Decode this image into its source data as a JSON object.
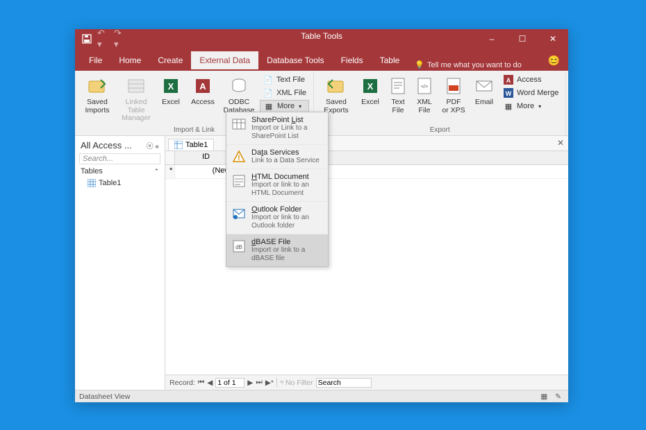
{
  "titlebar": {
    "center": "Table Tools",
    "minimize": "–",
    "maximize": "☐",
    "close": "✕"
  },
  "tabs": {
    "file": "File",
    "home": "Home",
    "create": "Create",
    "external": "External Data",
    "dbtools": "Database Tools",
    "fields": "Fields",
    "table": "Table",
    "tellme": "Tell me what you want to do"
  },
  "ribbon": {
    "group_import": "Import & Link",
    "group_export": "Export",
    "saved_imports": "Saved\nImports",
    "linked_mgr": "Linked Table\nManager",
    "excel": "Excel",
    "access": "Access",
    "odbc": "ODBC\nDatabase",
    "text_file": "Text File",
    "xml_file": "XML File",
    "more": "More",
    "saved_exports": "Saved\nExports",
    "excel2": "Excel",
    "text2": "Text\nFile",
    "xml2": "XML\nFile",
    "pdf": "PDF\nor XPS",
    "email": "Email",
    "exp_access": "Access",
    "exp_word": "Word Merge",
    "exp_more": "More"
  },
  "nav": {
    "title": "All Access ...",
    "search": "Search...",
    "group": "Tables",
    "item1": "Table1"
  },
  "doc": {
    "tab1": "Table1",
    "col_id": "ID",
    "new_row": "(New)"
  },
  "recnav": {
    "label": "Record:",
    "pos": "1 of 1",
    "filter": "No Filter",
    "search": "Search"
  },
  "status": {
    "text": "Datasheet View"
  },
  "dropdown": [
    {
      "title": "SharePoint List",
      "sub": "Import or Link to a SharePoint List",
      "hover": false
    },
    {
      "title": "Data Services",
      "sub": "Link to a Data Service",
      "hover": false
    },
    {
      "title": "HTML Document",
      "sub": "Import or link to an HTML Document",
      "hover": false
    },
    {
      "title": "Outlook Folder",
      "sub": "Import or link to an Outlook folder",
      "hover": false
    },
    {
      "title": "dBASE File",
      "sub": "Import or link to a dBASE file",
      "hover": true
    }
  ]
}
